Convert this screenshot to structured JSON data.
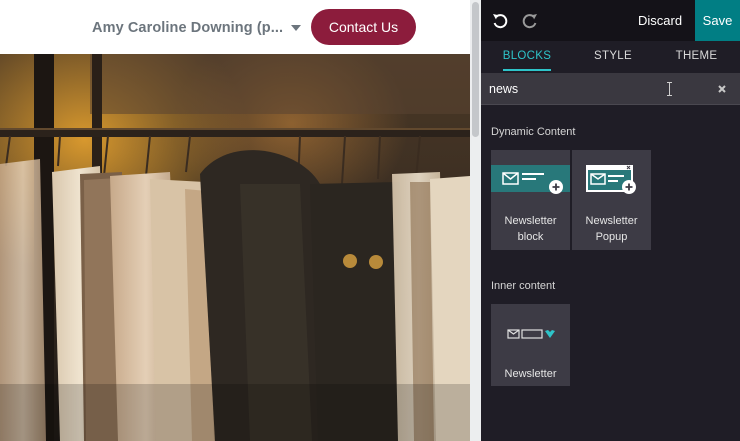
{
  "site": {
    "user_name": "Amy Caroline Downing (p...",
    "contact_label": "Contact Us",
    "colors": {
      "contact_button": "#8c1c3c",
      "user_name": "#6c757d"
    }
  },
  "editor": {
    "toolbar": {
      "undo_icon": "undo-icon",
      "redo_icon": "redo-icon",
      "discard_label": "Discard",
      "save_label": "Save"
    },
    "tabs": [
      {
        "label": "BLOCKS",
        "active": true
      },
      {
        "label": "STYLE",
        "active": false
      },
      {
        "label": "THEME",
        "active": false
      }
    ],
    "search": {
      "value": "news",
      "clear_icon": "close-icon"
    },
    "sections": [
      {
        "title": "Dynamic Content",
        "snippets": [
          {
            "label": "Newsletter block",
            "icon": "newsletter-block-thumbnail"
          },
          {
            "label": "Newsletter Popup",
            "icon": "newsletter-popup-thumbnail"
          }
        ]
      },
      {
        "title": "Inner content",
        "snippets": [
          {
            "label": "Newsletter",
            "icon": "newsletter-inline-thumbnail"
          }
        ]
      }
    ],
    "colors": {
      "accent": "#017e84",
      "active_tab": "#2ec4c9",
      "panel_bg": "#1f1d26"
    }
  }
}
